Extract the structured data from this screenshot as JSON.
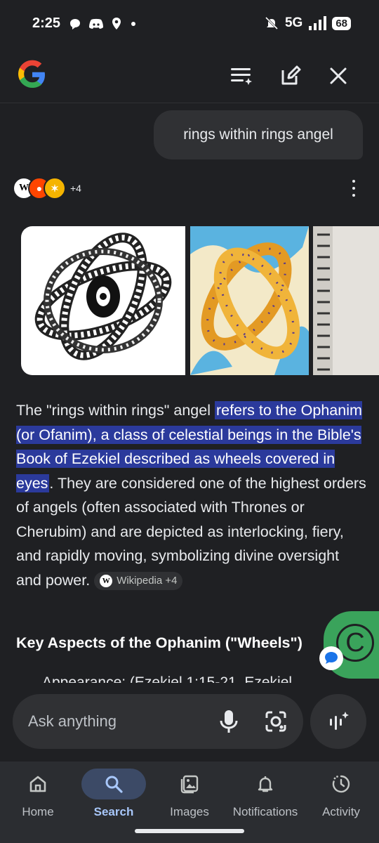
{
  "status_bar": {
    "time": "2:25",
    "network": "5G",
    "battery": "68"
  },
  "top_bar": {
    "logo": "google-logo",
    "icons": [
      "history-list-icon",
      "edit-icon",
      "close-icon"
    ]
  },
  "conversation": {
    "query": "rings within rings angel",
    "sources_more": "+4",
    "answer": {
      "prefix": "The \"rings within rings\" angel ",
      "highlight": "refers to the Ophanim (or Ofanim), a class of celestial beings in the Bible's Book of Ezekiel described as wheels covered in eyes",
      "rest": ". They are considered one of the highest orders of angels (often associated with Thrones or Cherubim) and are depicted as interlocking, fiery, and rapidly moving, symbolizing divine oversight and power.",
      "chip": "Wikipedia +4"
    },
    "heading": "Key Aspects of the Ophanim (\"Wheels\")",
    "cut_text": "Appearance: (Ezekiel 1:15-21, Ezekiel"
  },
  "fab": {
    "letter": "C"
  },
  "input": {
    "placeholder": "Ask anything"
  },
  "nav": {
    "items": [
      {
        "label": "Home",
        "icon": "home-icon"
      },
      {
        "label": "Search",
        "icon": "search-icon"
      },
      {
        "label": "Images",
        "icon": "images-icon"
      },
      {
        "label": "Notifications",
        "icon": "bell-icon"
      },
      {
        "label": "Activity",
        "icon": "activity-icon"
      }
    ],
    "active": "Search"
  },
  "colors": {
    "background": "#1f2023",
    "highlight": "#2b3a9c",
    "accent": "#a8c7fa",
    "fab": "#3aa35b"
  }
}
